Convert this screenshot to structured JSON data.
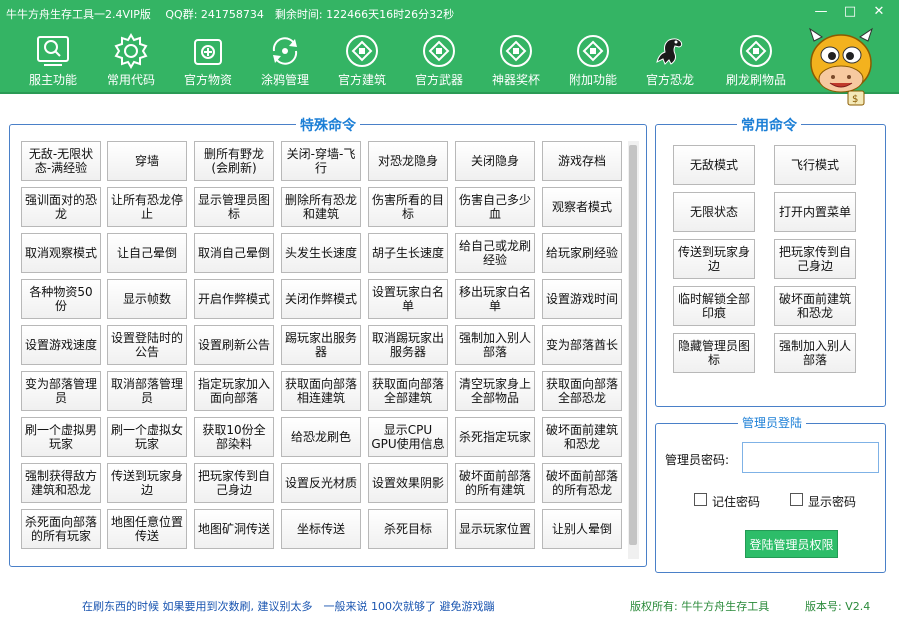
{
  "window": {
    "title": "牛牛方舟生存工具一2.4VIP版　 QQ群: 241758734　剩余时间: 122466天16时26分32秒",
    "controls": [
      "—",
      "□",
      "✕"
    ]
  },
  "toolbar": [
    {
      "label": "服主功能",
      "icon": "magnifier-screen-icon"
    },
    {
      "label": "常用代码",
      "icon": "gear-icon"
    },
    {
      "label": "官方物资",
      "icon": "package-icon"
    },
    {
      "label": "涂鸦管理",
      "icon": "refresh-icon"
    },
    {
      "label": "官方建筑",
      "icon": "coin-icon"
    },
    {
      "label": "官方武器",
      "icon": "coin-icon"
    },
    {
      "label": "神器奖杯",
      "icon": "coin-icon"
    },
    {
      "label": "附加功能",
      "icon": "coin-icon"
    },
    {
      "label": "官方恐龙",
      "icon": "dinosaur-icon"
    },
    {
      "label": "刷龙刷物品",
      "icon": "coin-icon"
    }
  ],
  "special": {
    "title": "特殊命令",
    "buttons": [
      "无敌-无限状态-满经验",
      "穿墙",
      "删所有野龙(会刷新)",
      "关闭-穿墙-飞行",
      "对恐龙隐身",
      "关闭隐身",
      "游戏存档",
      "强训面对的恐龙",
      "让所有恐龙停止",
      "显示管理员图标",
      "删除所有恐龙和建筑",
      "伤害所看的目标",
      "伤害自己多少血",
      "观察者模式",
      "取消观察模式",
      "让自己晕倒",
      "取消自己晕倒",
      "头发生长速度",
      "胡子生长速度",
      "给自己或龙刷经验",
      "给玩家刷经验",
      "各种物资50份",
      "显示帧数",
      "开启作弊模式",
      "关闭作弊模式",
      "设置玩家白名单",
      "移出玩家白名单",
      "设置游戏时间",
      "设置游戏速度",
      "设置登陆时的公告",
      "设置刷新公告",
      "踢玩家出服务器",
      "取消踢玩家出服务器",
      "强制加入别人部落",
      "变为部落酋长",
      "变为部落管理员",
      "取消部落管理员",
      "指定玩家加入面向部落",
      "获取面向部落相连建筑",
      "获取面向部落全部建筑",
      "清空玩家身上全部物品",
      "获取面向部落全部恐龙",
      "刷一个虚拟男玩家",
      "刷一个虚拟女玩家",
      "获取10份全部染料",
      "给恐龙刷色",
      "显示CPU GPU使用信息",
      "杀死指定玩家",
      "破坏面前建筑和恐龙",
      "强制获得敌方建筑和恐龙",
      "传送到玩家身边",
      "把玩家传到自己身边",
      "设置反光材质",
      "设置效果阴影",
      "破坏面前部落的所有建筑",
      "破坏面前部落的所有恐龙",
      "杀死面向部落的所有玩家",
      "地图任意位置传送",
      "地图矿洞传送",
      "坐标传送",
      "杀死目标",
      "显示玩家位置",
      "让别人晕倒"
    ]
  },
  "common": {
    "title": "常用命令",
    "buttons": [
      "无敌模式",
      "飞行模式",
      "无限状态",
      "打开内置菜单",
      "传送到玩家身边",
      "把玩家传到自己身边",
      "临时解锁全部印痕",
      "破坏面前建筑和恐龙",
      "隐藏管理员图标",
      "强制加入别人部落"
    ]
  },
  "admin": {
    "title": "管理员登陆",
    "password_label": "管理员密码:",
    "password_value": "",
    "remember_label": "记住密码",
    "show_label": "显示密码",
    "login_label": "登陆管理员权限"
  },
  "footer": {
    "tip": "在刷东西的时候 如果要用到次数刷, 建议别太多　一般来说 100次就够了 避免游戏蹦",
    "copyright": "版权所有: 牛牛方舟生存工具",
    "version": "版本号: V2.4"
  },
  "colors": {
    "accent": "#34b464",
    "panel_title": "#1c7fd6",
    "login": "#2dbd69"
  }
}
